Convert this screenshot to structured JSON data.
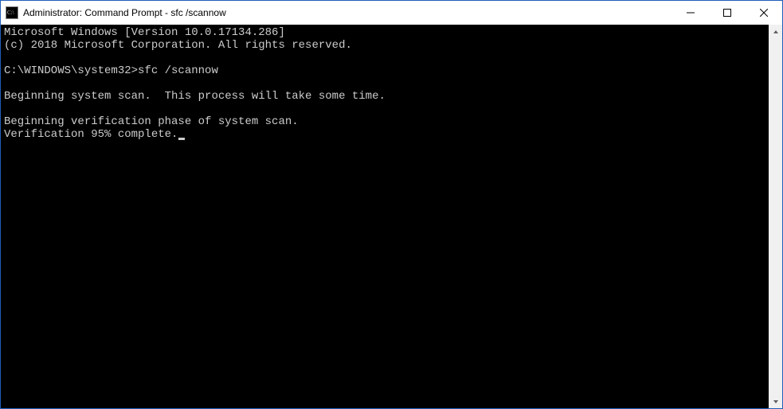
{
  "window": {
    "title": "Administrator: Command Prompt - sfc  /scannow"
  },
  "terminal": {
    "lines": [
      "Microsoft Windows [Version 10.0.17134.286]",
      "(c) 2018 Microsoft Corporation. All rights reserved.",
      "",
      "C:\\WINDOWS\\system32>sfc /scannow",
      "",
      "Beginning system scan.  This process will take some time.",
      "",
      "Beginning verification phase of system scan.",
      "Verification 95% complete."
    ],
    "cursor_after_last": true
  }
}
